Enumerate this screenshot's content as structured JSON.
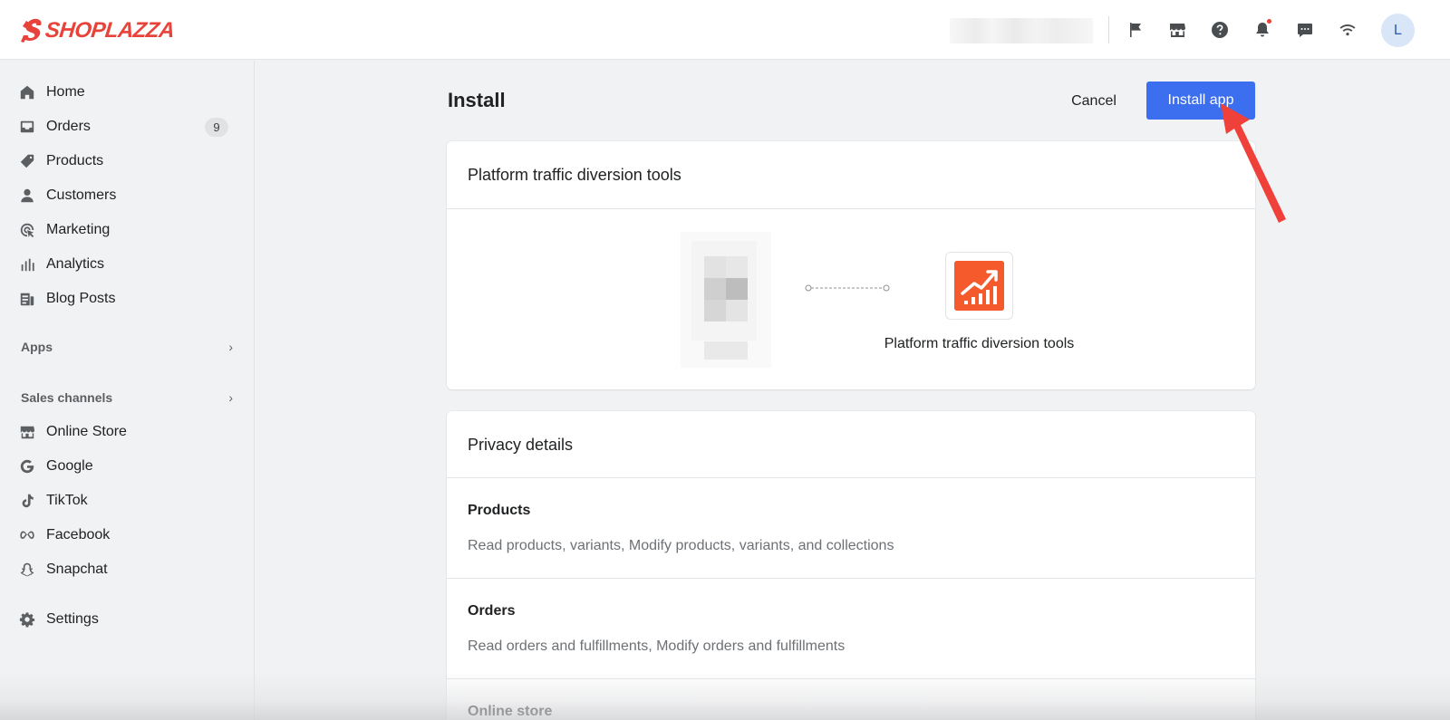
{
  "brand": {
    "name": "SHOPLAZZA",
    "color": "#e8433b"
  },
  "header": {
    "icons": [
      "flag-icon",
      "store-icon",
      "help-icon",
      "bell-icon",
      "chat-icon",
      "wifi-icon"
    ],
    "avatar_initial": "L"
  },
  "sidebar": {
    "items": [
      {
        "label": "Home",
        "icon": "home-icon"
      },
      {
        "label": "Orders",
        "icon": "orders-icon",
        "badge": "9"
      },
      {
        "label": "Products",
        "icon": "tag-icon"
      },
      {
        "label": "Customers",
        "icon": "person-icon"
      },
      {
        "label": "Marketing",
        "icon": "target-icon"
      },
      {
        "label": "Analytics",
        "icon": "bar-chart-icon"
      },
      {
        "label": "Blog Posts",
        "icon": "blog-icon"
      }
    ],
    "apps_label": "Apps",
    "sales_channels_label": "Sales channels",
    "channels": [
      {
        "label": "Online Store",
        "icon": "store-icon"
      },
      {
        "label": "Google",
        "icon": "google-icon"
      },
      {
        "label": "TikTok",
        "icon": "tiktok-icon"
      },
      {
        "label": "Facebook",
        "icon": "meta-icon"
      },
      {
        "label": "Snapchat",
        "icon": "snapchat-icon"
      }
    ],
    "settings_label": "Settings"
  },
  "main": {
    "title": "Install",
    "cancel_label": "Cancel",
    "install_label": "Install app",
    "install_color": "#3c6ff0",
    "app_card": {
      "title": "Platform traffic diversion tools",
      "app_name": "Platform traffic diversion tools",
      "app_color": "#f45a2c"
    },
    "privacy": {
      "title": "Privacy details",
      "permissions": [
        {
          "title": "Products",
          "desc": "Read products, variants, Modify products, variants, and collections"
        },
        {
          "title": "Orders",
          "desc": "Read orders and fulfillments, Modify orders and fulfillments"
        },
        {
          "title": "Online store",
          "desc": ""
        }
      ]
    }
  },
  "annotation": {
    "arrow_color": "#f0403a"
  }
}
